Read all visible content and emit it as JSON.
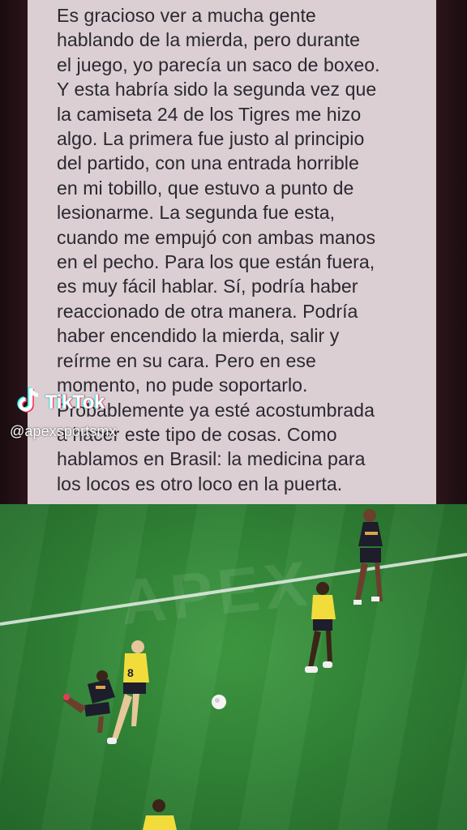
{
  "note": {
    "text": "Es gracioso ver a mucha gente\nhablando de la mierda, pero durante\nel juego, yo parecía un saco de boxeo.\nY esta habría sido la segunda vez que\nla camiseta 24 de los Tigres me hizo\nalgo. La primera fue justo al principio\ndel partido, con una entrada horrible\nen mi tobillo, que estuvo a punto de\nlesionarme. La segunda fue esta,\ncuando me empujó con ambas manos\nen el pecho. Para los que están fuera,\nes muy fácil hablar. Sí, podría haber\nreaccionado de otra manera. Podría\nhaber encendido la mierda, salir y\nreírme en su cara. Pero en ese\nmomento, no pude soportarlo.\nProbablemente ya esté acostumbrada\na hacer este tipo de cosas. Como\nhablamos en Brasil: la medicina para\nlos locos es otro loco en la puerta."
  },
  "watermark": {
    "app_name": "TikTok",
    "handle": "@apexsportsmx",
    "icon": "tiktok-icon"
  },
  "video": {
    "overlay_text": "APEX",
    "jersey_numbers": [
      "8"
    ],
    "colors": {
      "grass": "#2f8035",
      "yellow_kit": "#f2dc3c",
      "dark_kit": "#1d1d2b",
      "line": "#e8efe8"
    }
  }
}
